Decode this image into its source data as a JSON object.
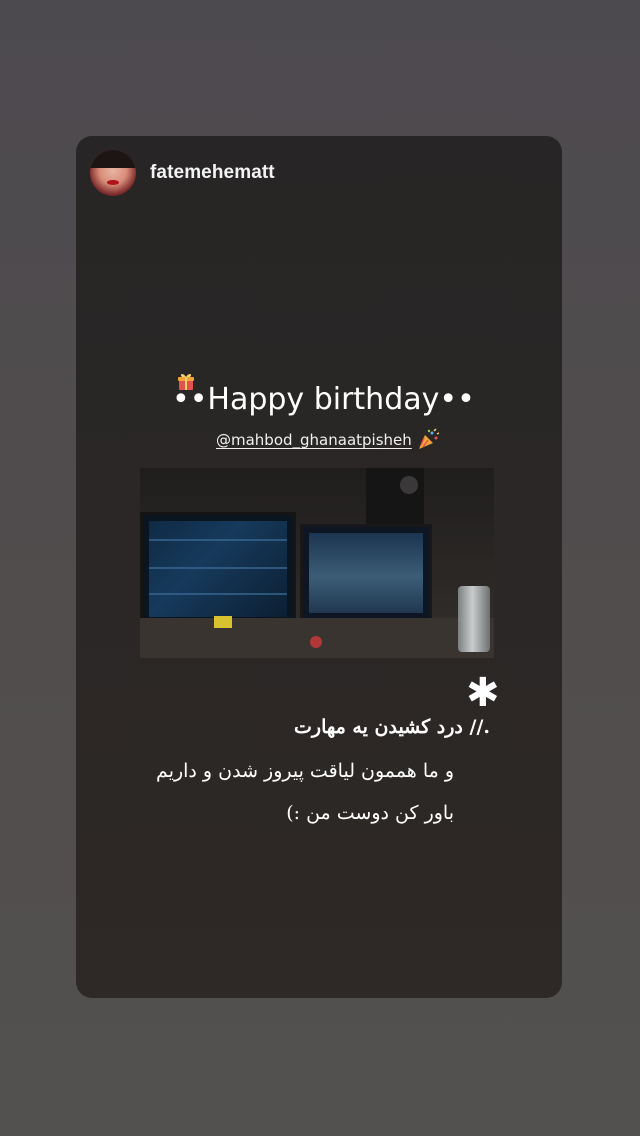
{
  "story": {
    "username": "fatemehematt",
    "title": "••Happy birthday••",
    "mention": "@mahbod_ghanaatpisheh",
    "asterisk": "✱",
    "text_lines": [
      ".//  درد کشیدن یه مهارت",
      "و ما هممون لیاقت پیروز شدن و داریم",
      "باور کن دوست من :)"
    ],
    "icons": {
      "gift": "gift-icon",
      "party": "party-popper-icon"
    }
  },
  "colors": {
    "page_background": "#4f4b4e",
    "card_background": "#2a2726",
    "text": "#ffffff"
  }
}
